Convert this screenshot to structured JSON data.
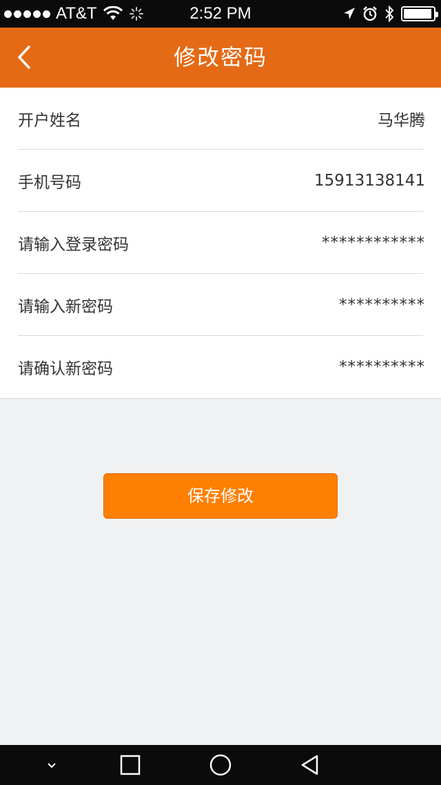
{
  "status_bar": {
    "carrier": "AT&T",
    "time": "2:52 PM",
    "icons": [
      "signal-icon",
      "wifi-icon",
      "loading-icon",
      "location-icon",
      "alarm-icon",
      "bluetooth-icon",
      "battery-icon"
    ]
  },
  "header": {
    "title": "修改密码",
    "back_icon": "chevron-left-icon"
  },
  "form": {
    "rows": [
      {
        "label": "开户姓名",
        "value": "马华腾"
      },
      {
        "label": "手机号码",
        "value": "15913138141"
      },
      {
        "label": "请输入登录密码",
        "value": "************"
      },
      {
        "label": "请输入新密码",
        "value": "**********"
      },
      {
        "label": "请确认新密码",
        "value": "**********"
      }
    ]
  },
  "save_button": {
    "label": "保存修改"
  },
  "nav_bar": {
    "icons": [
      "chevron-down-icon",
      "square-icon",
      "circle-icon",
      "triangle-back-icon"
    ]
  },
  "colors": {
    "header": "#e46a16",
    "button": "#ff7f00",
    "background": "#f0f1f3"
  }
}
